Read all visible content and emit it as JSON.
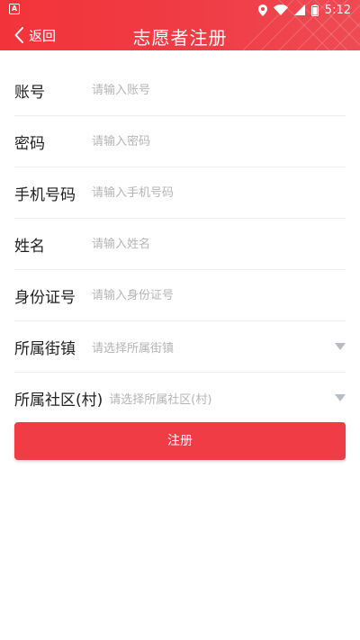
{
  "status_bar": {
    "left_badge": "A",
    "time": "5:12",
    "icons": [
      "location-icon",
      "wifi-icon",
      "signal-icon",
      "battery-icon"
    ]
  },
  "header": {
    "back_label": "返回",
    "title": "志愿者注册",
    "accent_color": "#f03c45"
  },
  "form": {
    "account": {
      "label": "账号",
      "placeholder": "请输入账号"
    },
    "password": {
      "label": "密码",
      "placeholder": "请输入密码"
    },
    "phone": {
      "label": "手机号码",
      "placeholder": "请输入手机号码"
    },
    "name": {
      "label": "姓名",
      "placeholder": "请输入姓名"
    },
    "id_number": {
      "label": "身份证号",
      "placeholder": "请输入身份证号"
    },
    "street": {
      "label": "所属街镇",
      "placeholder": "请选择所属街镇"
    },
    "community": {
      "label": "所属社区(村)",
      "placeholder": "请选择所属社区(村)"
    }
  },
  "submit": {
    "label": "注册"
  }
}
